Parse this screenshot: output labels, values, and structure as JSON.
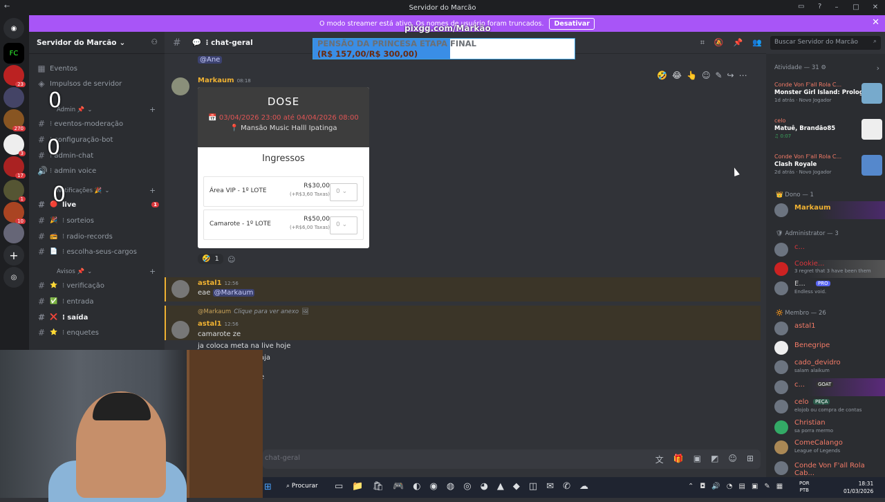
{
  "window": {
    "title": "Servidor do Marcão"
  },
  "banner": {
    "text": "O modo streamer está ativo. Os nomes de usuário foram truncados.",
    "button": "Desativar"
  },
  "watermark": "pixgg.com/Markão",
  "overlay": {
    "line1": "PENSÃO DA PRINCESA ETAPA FINAL",
    "line2": "(R$ 157,00/R$ 300,00)",
    "progress_fraction": 0.523
  },
  "server": {
    "name": "Servidor do Marcão"
  },
  "overlay_zeros": [
    "0",
    "0",
    "0"
  ],
  "guild_badges": [
    "23",
    "270",
    "3",
    "17",
    "1",
    "10"
  ],
  "channels": {
    "top": [
      {
        "label": "Eventos"
      },
      {
        "label": "Impulsos de servidor"
      }
    ],
    "admin_category": "Admin 📌",
    "admin": [
      "⁝ eventos-moderação",
      "⁝ configuração-bot",
      "⁝ admin-chat",
      "⁝ admin voice"
    ],
    "notif_category": "Notificações 🎉",
    "notif": [
      {
        "label": "live",
        "badge": "1"
      },
      {
        "label": "⁝ sorteios"
      },
      {
        "label": "⁝ radio-records"
      },
      {
        "label": "⁝ escolha-seus-cargos"
      }
    ],
    "avisos_category": "Avisos 📌",
    "avisos": [
      {
        "label": "⁝ verificação",
        "emoji": "⭐"
      },
      {
        "label": "⁝ entrada",
        "emoji": "✅"
      },
      {
        "label": "⁝ saída",
        "emoji": "❌"
      },
      {
        "label": "⁝ enquetes",
        "emoji": "⭐"
      }
    ]
  },
  "header": {
    "channel": "⁝ chat-geral"
  },
  "search": {
    "placeholder": "Buscar Servidor do Marcão"
  },
  "messages": {
    "mention_top": "@Ane",
    "m1": {
      "author": "Markaum",
      "time": "08:18"
    },
    "event_card": {
      "title": "DOSE",
      "date": "03/04/2026 23:00 até 04/04/2026 08:00",
      "location": "Mansão Music Halll Ipatinga",
      "section": "Ingressos",
      "tickets": [
        {
          "name": "Área VIP - 1º LOTE",
          "price": "R$30,00",
          "fee": "(+R$3,60 Taxas)",
          "qty": "0"
        },
        {
          "name": "Camarote - 1º LOTE",
          "price": "R$50,00",
          "fee": "(+R$6,00 Taxas)",
          "qty": "0"
        }
      ]
    },
    "reaction_count": "1",
    "m2": {
      "author": "astal1",
      "time": "12:56",
      "text": "eae",
      "mention": "@Markaum"
    },
    "reply": {
      "mention": "@Markaum",
      "text": "Clique para ver anexo"
    },
    "m3": {
      "author": "astal1",
      "time": "12:56",
      "lines": [
        "camarote ze",
        "ja coloca meta na live hoje",
        "aja",
        "e"
      ]
    }
  },
  "composer": {
    "placeholder": "chat-geral"
  },
  "members": {
    "activity_header": "Atividade — 31",
    "activities": [
      {
        "user": "Conde Von F'all Rola C...",
        "game": "Monster Girl Island: Prolog...",
        "status": "1d atrás · Novo Jogador"
      },
      {
        "user": "celo",
        "game": "Matuê, Brandão85",
        "status": "♫ 0:07"
      },
      {
        "user": "Conde Von F'all Rola C...",
        "game": "Clash Royale",
        "status": "2d atrás · Novo Jogador"
      }
    ],
    "owner_header": "Dono — 1",
    "owner": [
      {
        "name": "Markaum"
      }
    ],
    "admin_header": "Administrator — 3",
    "admins": [
      {
        "name": "c...",
        "status": ""
      },
      {
        "name": "Cookie...",
        "status": "3 regret that 3 have been them"
      },
      {
        "name": "E...",
        "tag": "PRO",
        "status": "Endless void."
      }
    ],
    "member_header": "Membro — 26",
    "members": [
      {
        "name": "astal1",
        "status": ""
      },
      {
        "name": "Benegripe",
        "status": ""
      },
      {
        "name": "cado_devidro",
        "status": "salam alaikum"
      },
      {
        "name": "c...",
        "tag": "GOAT",
        "status": ""
      },
      {
        "name": "celo",
        "tag": "PEÇA",
        "status": "elojob ou compra de contas"
      },
      {
        "name": "Christian",
        "status": "sa porra mermo"
      },
      {
        "name": "ComeCalango",
        "status": "League of Legends"
      },
      {
        "name": "Conde Von F'all Rola Cab...",
        "status": ""
      }
    ]
  },
  "taskbar": {
    "search": "Procurar",
    "lang": "POR",
    "lang2": "PTB",
    "time": "18:31",
    "date": "01/03/2026"
  },
  "colors": {
    "accent": "#a855f7",
    "discord_bg": "#313338",
    "author": "#f0b232",
    "member": "#f47b67"
  }
}
